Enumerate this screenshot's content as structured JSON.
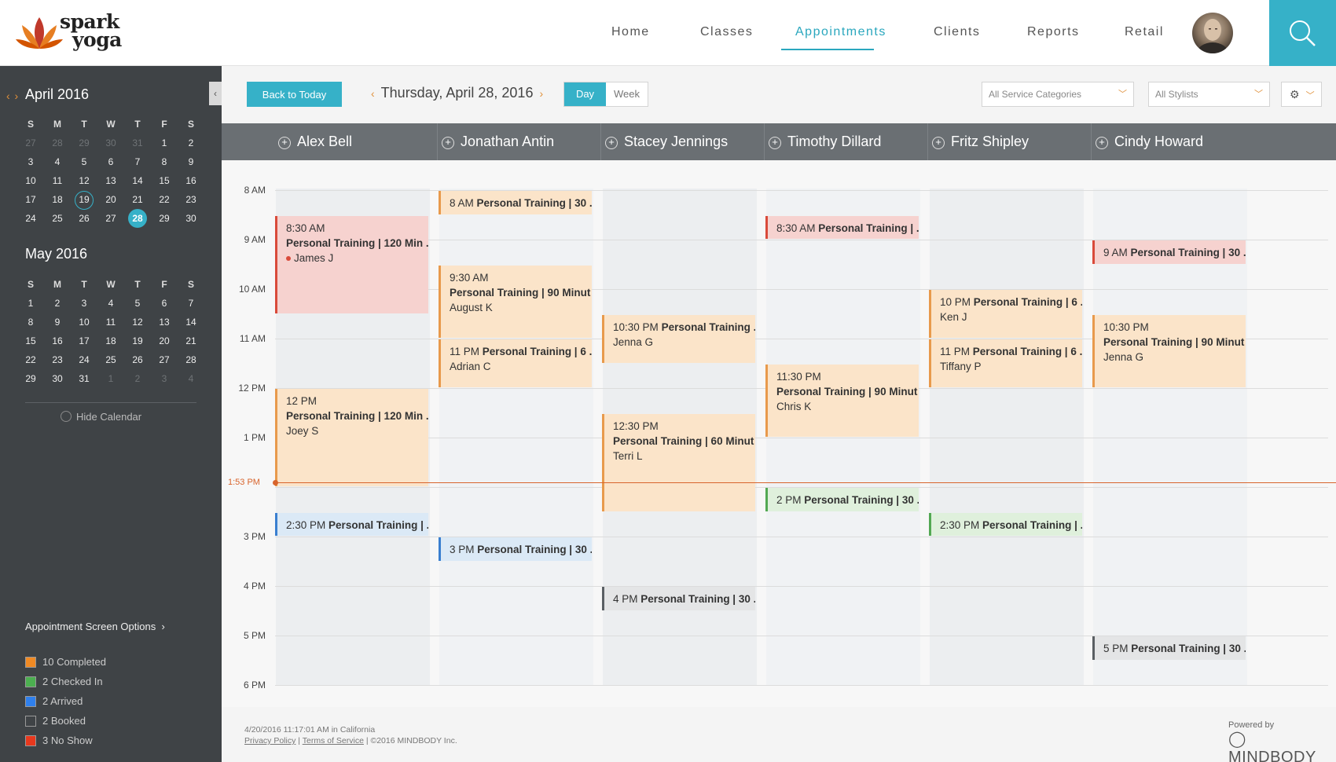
{
  "brand": {
    "line1": "spark",
    "line2": "yoga"
  },
  "nav": {
    "items": [
      {
        "label": "Home",
        "active": false
      },
      {
        "label": "Classes",
        "active": false
      },
      {
        "label": "Appointments",
        "active": true
      },
      {
        "label": "Clients",
        "active": false
      },
      {
        "label": "Reports",
        "active": false
      },
      {
        "label": "Retail",
        "active": false
      }
    ]
  },
  "sidebar": {
    "collapse_glyph": "‹",
    "month_arrows": "‹ ›",
    "april": {
      "title": "April 2016",
      "dow": [
        "S",
        "M",
        "T",
        "W",
        "T",
        "F",
        "S"
      ],
      "days": [
        "27",
        "28",
        "29",
        "30",
        "31",
        "1",
        "2",
        "3",
        "4",
        "5",
        "6",
        "7",
        "8",
        "9",
        "10",
        "11",
        "12",
        "13",
        "14",
        "15",
        "16",
        "17",
        "18",
        "19",
        "20",
        "21",
        "22",
        "23",
        "24",
        "25",
        "26",
        "27",
        "28",
        "29",
        "30"
      ],
      "muted_count_start": 5,
      "today": "19",
      "selected": "28"
    },
    "may": {
      "title": "May 2016",
      "dow": [
        "S",
        "M",
        "T",
        "W",
        "T",
        "F",
        "S"
      ],
      "days": [
        "1",
        "2",
        "3",
        "4",
        "5",
        "6",
        "7",
        "8",
        "9",
        "10",
        "11",
        "12",
        "13",
        "14",
        "15",
        "16",
        "17",
        "18",
        "19",
        "20",
        "21",
        "22",
        "23",
        "24",
        "25",
        "26",
        "27",
        "28",
        "29",
        "30",
        "31",
        "1",
        "2",
        "3",
        "4"
      ],
      "muted_count_end": 4
    },
    "hide_calendar": "Hide Calendar",
    "options_title": "Appointment Screen Options",
    "options_chevron": "›",
    "legend": [
      {
        "label": "10 Completed",
        "color": "#f08a24"
      },
      {
        "label": "2 Checked In",
        "color": "#4caf50"
      },
      {
        "label": "2 Arrived",
        "color": "#2f80ed"
      },
      {
        "label": "2 Booked",
        "color": "#3f4346"
      },
      {
        "label": "3 No Show",
        "color": "#e8381d"
      }
    ]
  },
  "toolbar": {
    "back_to_today": "Back to Today",
    "prev_arrow": "‹",
    "next_arrow": "›",
    "date": "Thursday, April 28, 2016",
    "view_day": "Day",
    "view_week": "Week",
    "service_categories": "All Service Categories",
    "stylists": "All Stylists",
    "gear": "⚙",
    "chevron": "﹀"
  },
  "staff": [
    "Alex Bell",
    "Jonathan Antin",
    "Stacey Jennings",
    "Timothy Dillard",
    "Fritz Shipley",
    "Cindy Howard"
  ],
  "hours": [
    "8 AM",
    "9 AM",
    "10 AM",
    "11 AM",
    "12 PM",
    "1 PM",
    "3 PM",
    "4 PM",
    "5 PM",
    "6 PM"
  ],
  "now_label": "1:53 PM",
  "appointments": [
    {
      "col": 0,
      "start": 8.5,
      "end": 10.5,
      "status": "red",
      "time": "8:30 AM",
      "title": "Personal Training | 120 Min ...",
      "client": "James J",
      "dot": true,
      "inline": false
    },
    {
      "col": 0,
      "start": 12.0,
      "end": 14.0,
      "status": "orange",
      "time": "12 PM",
      "title": "Personal Training | 120 Min ...",
      "client": "Joey S",
      "inline": false
    },
    {
      "col": 0,
      "start": 14.5,
      "end": 15.0,
      "status": "blue",
      "time": "2:30 PM",
      "title": "Personal Training | ...",
      "client": "",
      "inline": true
    },
    {
      "col": 1,
      "start": 8.0,
      "end": 8.5,
      "status": "orange",
      "time": "8 AM",
      "title": "Personal Training | 30 ...",
      "client": "",
      "inline": true
    },
    {
      "col": 1,
      "start": 9.5,
      "end": 11.0,
      "status": "orange",
      "time": "9:30 AM",
      "title": "Personal Training | 90 Minut ...",
      "client": "August K",
      "inline": false
    },
    {
      "col": 1,
      "start": 11.0,
      "end": 12.0,
      "status": "orange",
      "time": "11 PM",
      "title": "Personal Training | 6 ...",
      "client": "Adrian C",
      "inline": true
    },
    {
      "col": 1,
      "start": 15.0,
      "end": 15.5,
      "status": "blue",
      "time": "3 PM",
      "title": "Personal Training | 30 ...",
      "client": "",
      "inline": true
    },
    {
      "col": 2,
      "start": 10.5,
      "end": 11.5,
      "status": "orange",
      "time": "10:30 PM",
      "title": "Personal Training ...",
      "client": "Jenna G",
      "inline": true
    },
    {
      "col": 2,
      "start": 12.5,
      "end": 14.5,
      "status": "orange",
      "time": "12:30 PM",
      "title": "Personal Training | 60 Minut ...",
      "client": "Terri L",
      "inline": false
    },
    {
      "col": 2,
      "start": 16.0,
      "end": 16.5,
      "status": "gray",
      "time": "4 PM",
      "title": "Personal Training | 30 ...",
      "client": "",
      "inline": true
    },
    {
      "col": 3,
      "start": 8.5,
      "end": 9.0,
      "status": "red",
      "time": "8:30 AM",
      "title": "Personal Training | ...",
      "client": "",
      "inline": true
    },
    {
      "col": 3,
      "start": 11.5,
      "end": 13.0,
      "status": "orange",
      "time": "11:30 PM",
      "title": "Personal Training | 90 Minut ...",
      "client": "Chris K",
      "inline": false
    },
    {
      "col": 3,
      "start": 14.0,
      "end": 14.5,
      "status": "green",
      "time": "2 PM",
      "title": "Personal Training | 30 ...",
      "client": "",
      "inline": true
    },
    {
      "col": 4,
      "start": 10.0,
      "end": 11.0,
      "status": "orange",
      "time": "10 PM",
      "title": "Personal Training | 6 ...",
      "client": "Ken J",
      "inline": true
    },
    {
      "col": 4,
      "start": 11.0,
      "end": 12.0,
      "status": "orange",
      "time": "11 PM",
      "title": "Personal Training | 6 ...",
      "client": "Tiffany P",
      "inline": true
    },
    {
      "col": 4,
      "start": 14.5,
      "end": 15.0,
      "status": "green",
      "time": "2:30 PM",
      "title": "Personal Training | ...",
      "client": "",
      "inline": true
    },
    {
      "col": 5,
      "start": 9.0,
      "end": 9.5,
      "status": "red",
      "time": "9 AM",
      "title": "Personal Training | 30 ...",
      "client": "",
      "inline": true
    },
    {
      "col": 5,
      "start": 10.5,
      "end": 12.0,
      "status": "orange",
      "time": "10:30 PM",
      "title": "Personal Training | 90 Minut ...",
      "client": "Jenna G",
      "inline": false
    },
    {
      "col": 5,
      "start": 17.0,
      "end": 17.5,
      "status": "gray",
      "time": "5 PM",
      "title": "Personal Training | 30 ...",
      "client": "",
      "inline": true
    }
  ],
  "footer": {
    "timestamp": "4/20/2016 11:17:01 AM in California",
    "privacy": "Privacy Policy",
    "terms": "Terms of Service",
    "copyright": "©2016 MINDBODY Inc.",
    "powered_by": "Powered by",
    "brand": "MINDBODY"
  }
}
